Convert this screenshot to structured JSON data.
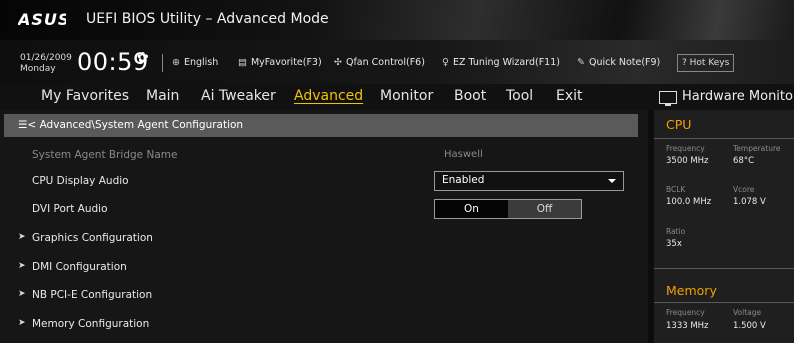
{
  "header": {
    "logo_text": "ASUS",
    "title": "UEFI BIOS Utility – Advanced Mode",
    "date": "01/26/2009",
    "day": "Monday",
    "time": "00:59"
  },
  "toolbar": {
    "language": "English",
    "myfavorite": "MyFavorite(F3)",
    "qfan": "Qfan Control(F6)",
    "eztuning": "EZ Tuning Wizard(F11)",
    "quicknote": "Quick Note(F9)",
    "hotkeys": "Hot Keys",
    "hotkeys_symbol": "?"
  },
  "tabs": {
    "favorites": "My Favorites",
    "main": "Main",
    "aitweaker": "Ai Tweaker",
    "advanced": "Advanced",
    "monitor": "Monitor",
    "boot": "Boot",
    "tool": "Tool",
    "exit": "Exit"
  },
  "breadcrumb": "Advanced\\System Agent Configuration",
  "settings": {
    "bridge_name_label": "System Agent Bridge Name",
    "bridge_name_value": "Haswell",
    "cpu_audio_label": "CPU Display Audio",
    "cpu_audio_value": "Enabled",
    "dvi_audio_label": "DVI Port Audio",
    "dvi_on": "On",
    "dvi_off": "Off",
    "submenus": [
      "Graphics Configuration",
      "DMI Configuration",
      "NB PCI-E Configuration",
      "Memory Configuration"
    ]
  },
  "hw_monitor": {
    "title": "Hardware Monitor",
    "cpu": {
      "heading": "CPU",
      "frequency_label": "Frequency",
      "frequency": "3500 MHz",
      "temperature_label": "Temperature",
      "temperature": "68°C",
      "bclk_label": "BCLK",
      "bclk": "100.0 MHz",
      "vcore_label": "Vcore",
      "vcore": "1.078 V",
      "ratio_label": "Ratio",
      "ratio": "35x"
    },
    "memory": {
      "heading": "Memory",
      "frequency_label": "Frequency",
      "frequency": "1333 MHz",
      "voltage_label": "Voltage",
      "voltage": "1.500 V"
    }
  },
  "colors": {
    "accent": "#f2c400",
    "hw_heading": "#f2a000",
    "breadcrumb_bg": "#5a5a5a"
  }
}
